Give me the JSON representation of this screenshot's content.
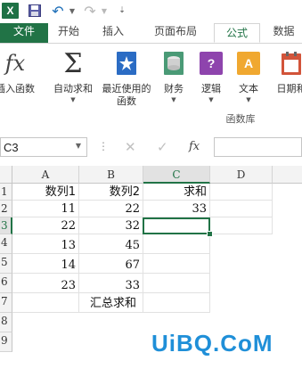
{
  "quick_access": {
    "app_logo": "X",
    "icons": [
      "excel-logo",
      "save-icon",
      "undo-icon",
      "redo-icon",
      "customize-icon"
    ]
  },
  "tabs": [
    {
      "label": "文件",
      "active": false
    },
    {
      "label": "开始",
      "active": false
    },
    {
      "label": "插入",
      "active": false
    },
    {
      "label": "页面布局",
      "active": false
    },
    {
      "label": "公式",
      "active": true
    },
    {
      "label": "数据",
      "active": false
    }
  ],
  "ribbon": {
    "insert_function": "插入函数",
    "insert_function_glyph": "fx",
    "autosum_glyph": "Σ",
    "autosum": "自动求和",
    "recent_line1": "最近使用的",
    "recent_line2": "函数",
    "financial": "财务",
    "logical": "逻辑",
    "logical_glyph": "?",
    "text": "文本",
    "text_glyph": "A",
    "datetime": "日期和",
    "group_label": "函数库"
  },
  "formula_bar": {
    "name_box": "C3",
    "fx_label": "fx",
    "formula": ""
  },
  "grid": {
    "columns": [
      "A",
      "B",
      "C",
      "D"
    ],
    "rows": [
      "1",
      "2",
      "3",
      "4",
      "5",
      "6",
      "7",
      "8",
      "9"
    ],
    "selected_cell": "C3",
    "cells": {
      "A1": "数列1",
      "B1": "数列2",
      "C1": "求和",
      "A2": "11",
      "B2": "22",
      "C2": "33",
      "A3": "22",
      "B3": "32",
      "A4": "13",
      "B4": "45",
      "A5": "14",
      "B5": "67",
      "A6": "23",
      "B6": "33",
      "B7": "汇总求和"
    }
  },
  "watermark": "UiBQ.CoM",
  "colors": {
    "excel_green": "#217346",
    "watermark_blue": "#1f8fd8"
  }
}
